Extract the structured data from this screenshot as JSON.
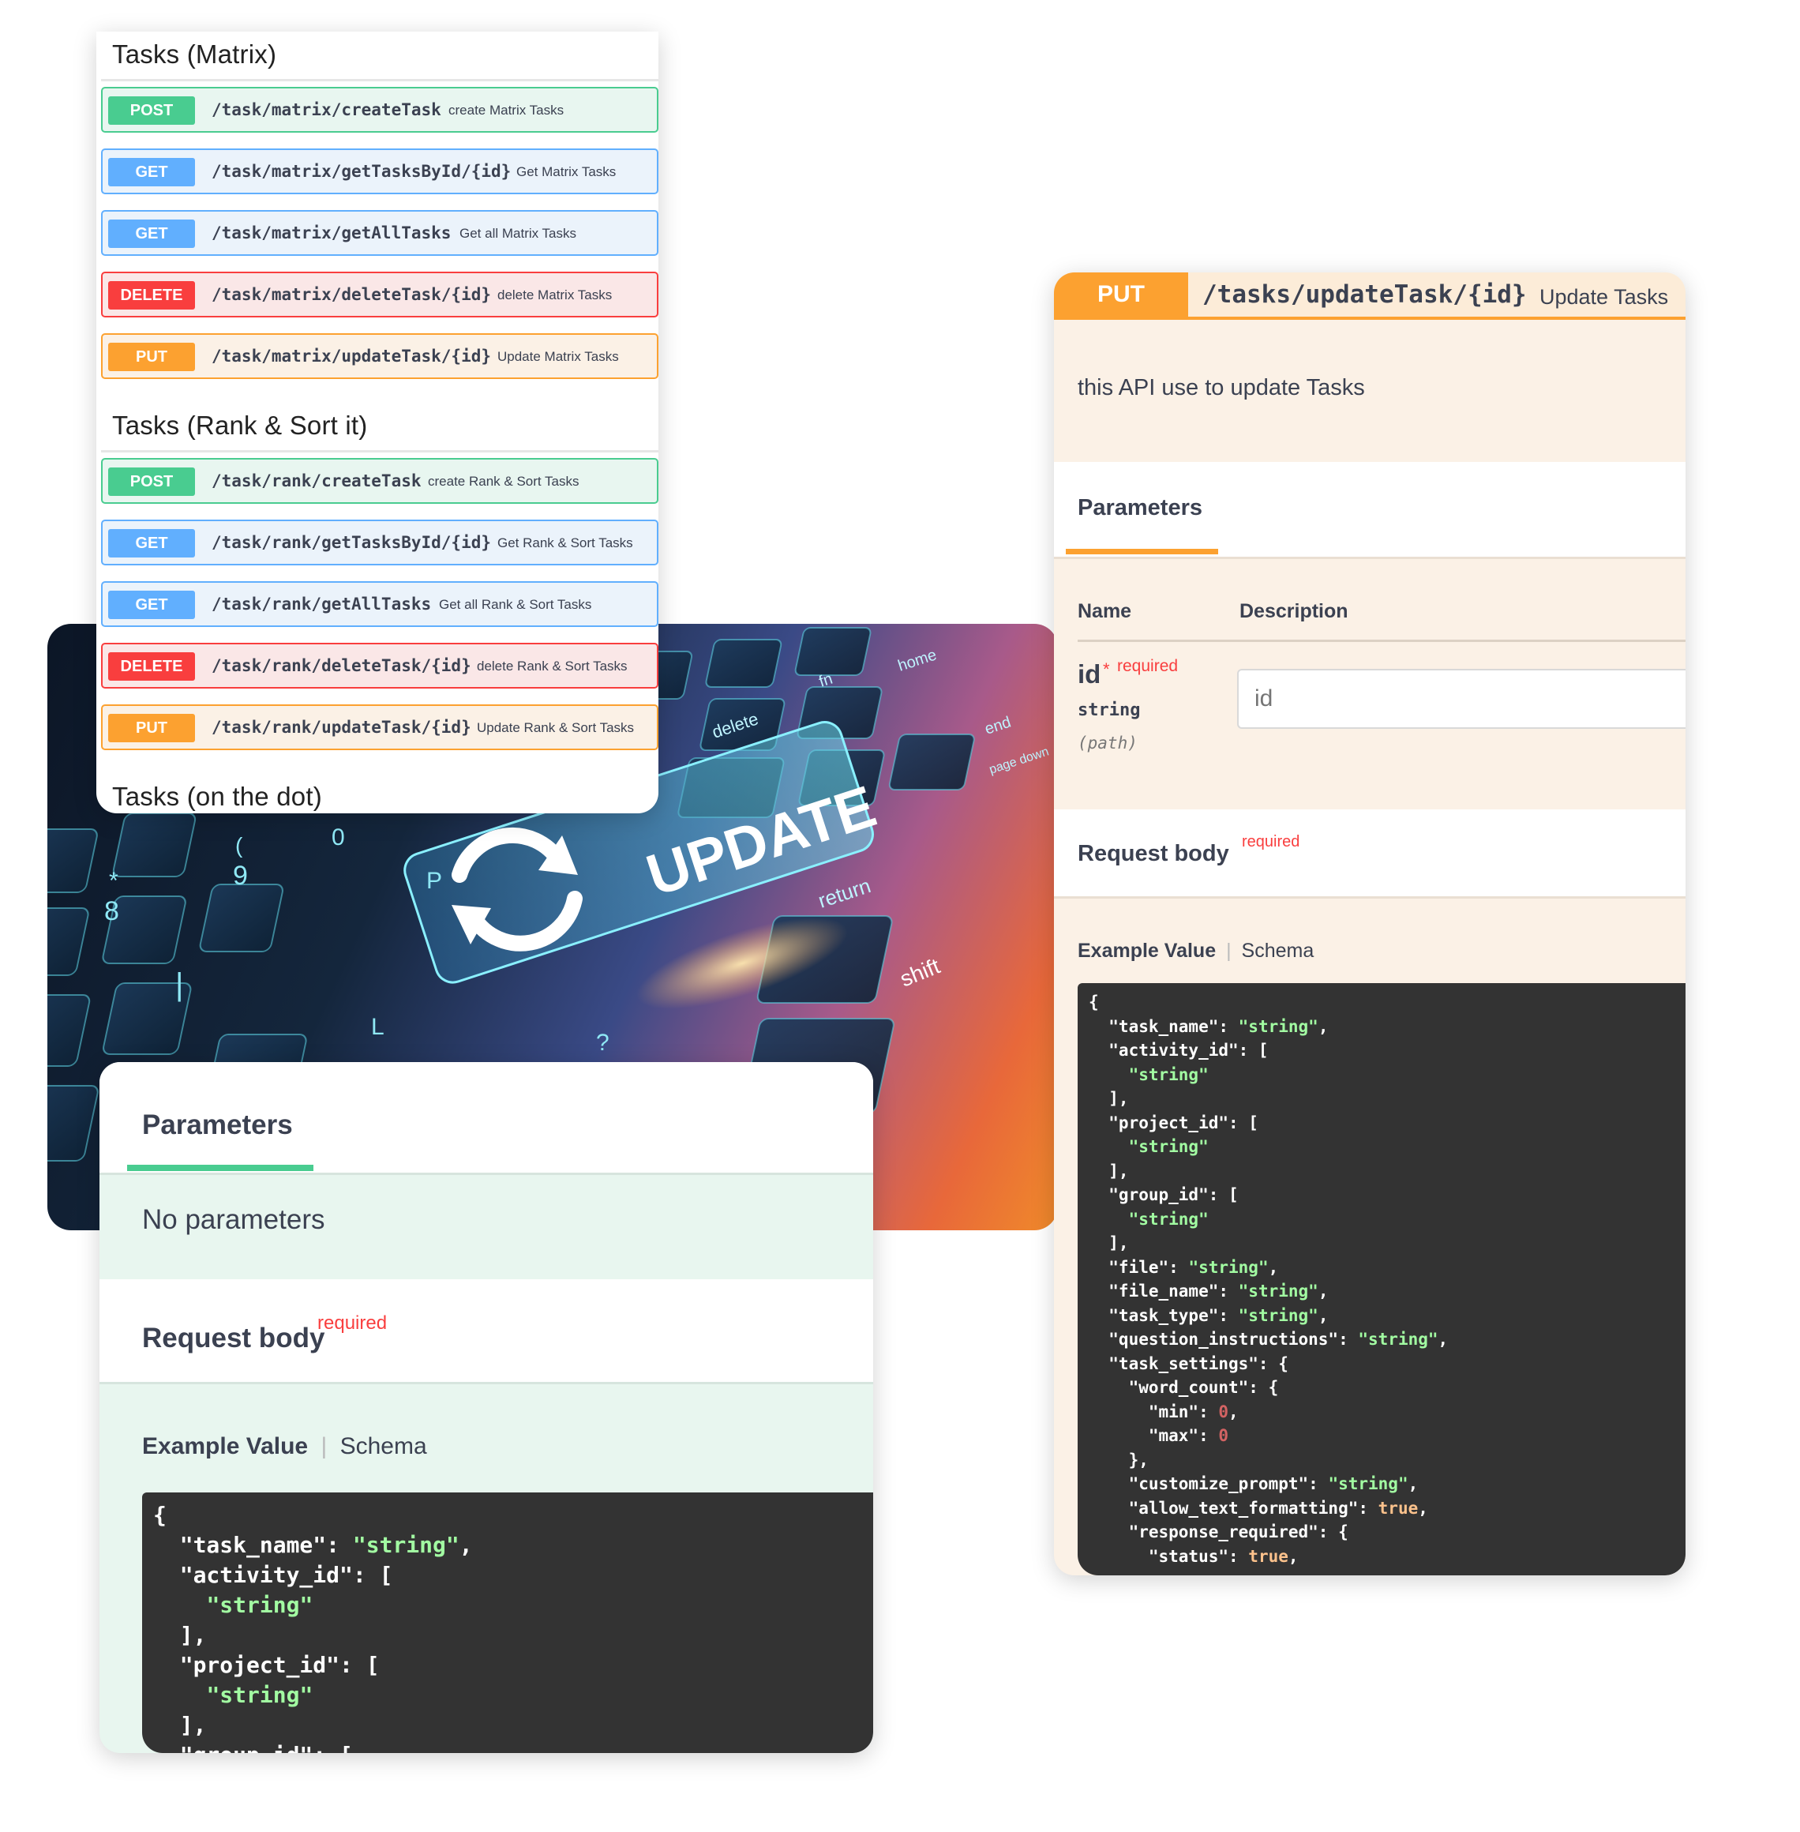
{
  "endpoint_list": {
    "groups": [
      {
        "title": "Tasks (Matrix)",
        "operations": [
          {
            "method": "POST",
            "path": "/task/matrix/createTask",
            "summary": "create Matrix Tasks"
          },
          {
            "method": "GET",
            "path": "/task/matrix/getTasksById/{id}",
            "summary": "Get Matrix Tasks"
          },
          {
            "method": "GET",
            "path": "/task/matrix/getAllTasks",
            "summary": "Get all Matrix Tasks"
          },
          {
            "method": "DELETE",
            "path": "/task/matrix/deleteTask/{id}",
            "summary": "delete Matrix Tasks"
          },
          {
            "method": "PUT",
            "path": "/task/matrix/updateTask/{id}",
            "summary": "Update Matrix Tasks"
          }
        ]
      },
      {
        "title": "Tasks (Rank & Sort it)",
        "operations": [
          {
            "method": "POST",
            "path": "/task/rank/createTask",
            "summary": "create Rank & Sort Tasks"
          },
          {
            "method": "GET",
            "path": "/task/rank/getTasksById/{id}",
            "summary": "Get Rank & Sort Tasks"
          },
          {
            "method": "GET",
            "path": "/task/rank/getAllTasks",
            "summary": "Get all Rank & Sort Tasks"
          },
          {
            "method": "DELETE",
            "path": "/task/rank/deleteTask/{id}",
            "summary": "delete Rank & Sort Tasks"
          },
          {
            "method": "PUT",
            "path": "/task/rank/updateTask/{id}",
            "summary": "Update Rank & Sort Tasks"
          }
        ]
      },
      {
        "title": "Tasks (on the dot)",
        "operations": []
      }
    ]
  },
  "hero": {
    "key_label": "UPDATE",
    "return_label": "return",
    "shift_label": "shift",
    "delete_label": "delete",
    "home_label": "home",
    "fn_label": "fn",
    "end_label": "end",
    "page_down_label": "page down",
    "digit_8": "8",
    "digit_9": "9",
    "digit_0": "0",
    "paren": "(",
    "star": "*",
    "p_key": "P",
    "l_key": "L",
    "question": "?",
    "pipe": "|"
  },
  "post_detail": {
    "parameters_tab": "Parameters",
    "no_parameters": "No parameters",
    "request_body": "Request body",
    "required": "required",
    "example_value": "Example Value",
    "separator": "|",
    "schema": "Schema",
    "code_lines": [
      "{",
      "  \"task_name\": \"string\",",
      "  \"activity_id\": [",
      "    \"string\"",
      "  ],",
      "  \"project_id\": [",
      "    \"string\"",
      "  ],",
      "  \"group_id\": ["
    ]
  },
  "put_detail": {
    "method": "PUT",
    "path": "/tasks/updateTask/{id}",
    "summary": "Update Tasks",
    "description": "this API use to update Tasks",
    "parameters_tab": "Parameters",
    "col_name": "Name",
    "col_description": "Description",
    "param_name": "id",
    "param_star": "*",
    "param_required": "required",
    "param_type": "string",
    "param_in": "(path)",
    "input_placeholder": "id",
    "request_body": "Request body",
    "required": "required",
    "example_value": "Example Value",
    "separator": "|",
    "schema": "Schema",
    "code_lines": [
      "{",
      "  \"task_name\": \"string\",",
      "  \"activity_id\": [",
      "    \"string\"",
      "  ],",
      "  \"project_id\": [",
      "    \"string\"",
      "  ],",
      "  \"group_id\": [",
      "    \"string\"",
      "  ],",
      "  \"file\": \"string\",",
      "  \"file_name\": \"string\",",
      "  \"task_type\": \"string\",",
      "  \"question_instructions\": \"string\",",
      "  \"task_settings\": {",
      "    \"word_count\": {",
      "      \"min\": 0,",
      "      \"max\": 0",
      "    },",
      "    \"customize_prompt\": \"string\",",
      "    \"allow_text_formatting\": true,",
      "    \"response_required\": {",
      "      \"status\": true,"
    ]
  },
  "colors": {
    "post": "#49cc90",
    "get": "#61affe",
    "delete": "#f93e3e",
    "put": "#fca130",
    "code_bg": "#333333",
    "code_string": "#a2fca2",
    "code_number": "#d36363",
    "code_bool": "#fcc28c"
  }
}
